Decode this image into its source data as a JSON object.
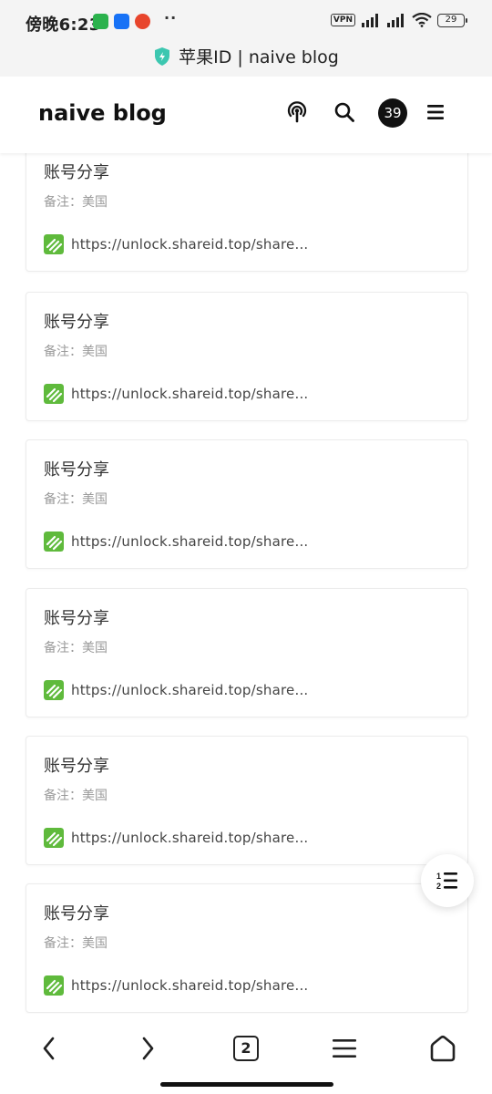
{
  "status_bar": {
    "time": "傍晚6:23",
    "dots": "··",
    "vpn": "VPN",
    "battery": "29"
  },
  "url_bar": {
    "title": "苹果ID | naive blog"
  },
  "header": {
    "site_title": "naive blog",
    "badge": "39"
  },
  "cards": [
    {
      "title": "账号分享",
      "note": "备注：美国",
      "link": "https://unlock.shareid.top/share..."
    },
    {
      "title": "账号分享",
      "note": "备注：美国",
      "link": "https://unlock.shareid.top/share..."
    },
    {
      "title": "账号分享",
      "note": "备注：美国",
      "link": "https://unlock.shareid.top/share..."
    },
    {
      "title": "账号分享",
      "note": "备注：美国",
      "link": "https://unlock.shareid.top/share..."
    },
    {
      "title": "账号分享",
      "note": "备注：美国",
      "link": "https://unlock.shareid.top/share..."
    },
    {
      "title": "账号分享",
      "note": "备注：美国",
      "link": "https://unlock.shareid.top/share..."
    }
  ],
  "bottom_nav": {
    "tab_count": "2"
  },
  "icons": {
    "shield": "shield-icon",
    "podcast": "podcast-icon",
    "search": "search-icon",
    "menu": "menu-icon",
    "link": "link-favicon-icon",
    "toc": "numbered-list-icon",
    "back": "back-icon",
    "forward": "forward-icon",
    "tabs": "tabs-icon",
    "browser_menu": "hamburger-icon",
    "home": "home-icon"
  },
  "colors": {
    "accent_green": "#5fba3c",
    "shield_teal": "#3cc7b0"
  }
}
